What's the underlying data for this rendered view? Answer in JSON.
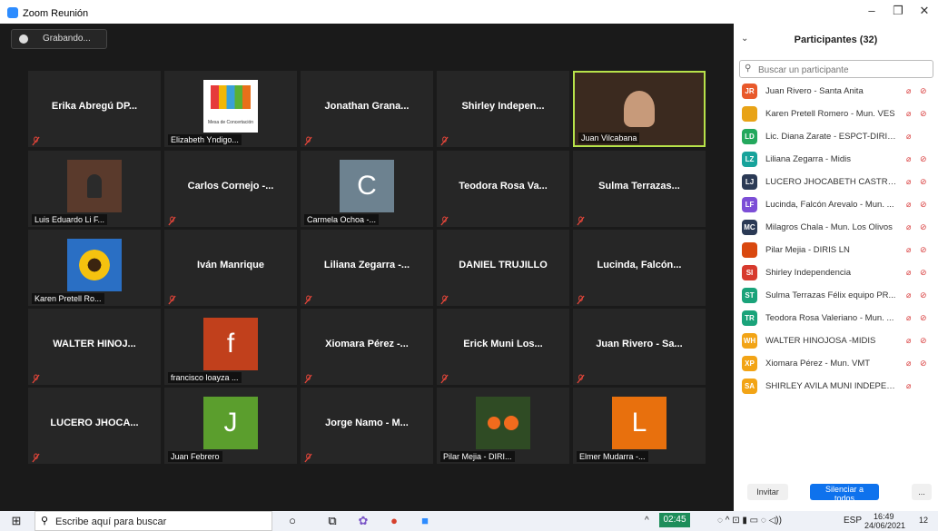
{
  "window": {
    "title": "Zoom Reunión",
    "minimize": "–",
    "maximize": "❐",
    "close": "✕"
  },
  "recording": {
    "label": "Grabando..."
  },
  "grid": [
    {
      "name": "Erika Abregú DP...",
      "label": "",
      "kind": "name"
    },
    {
      "name": "",
      "label": "Elizabeth Yndigo...",
      "kind": "logo",
      "logo_text": "Mesa de Concertación"
    },
    {
      "name": "Jonathan Grana...",
      "label": "",
      "kind": "name"
    },
    {
      "name": "Shirley Indepen...",
      "label": "",
      "kind": "name"
    },
    {
      "name": "",
      "label": "Juan Vilcabana",
      "kind": "video",
      "active": true
    },
    {
      "name": "",
      "label": "Luis Eduardo Li F...",
      "kind": "photo-person"
    },
    {
      "name": "Carlos Cornejo -...",
      "label": "",
      "kind": "name"
    },
    {
      "name": "",
      "label": "Carmela Ochoa -...",
      "kind": "letter",
      "letter": "C",
      "color": "#6d8290"
    },
    {
      "name": "Teodora Rosa Va...",
      "label": "",
      "kind": "name"
    },
    {
      "name": "Sulma Terrazas...",
      "label": "",
      "kind": "name"
    },
    {
      "name": "",
      "label": "Karen Pretell Ro...",
      "kind": "sunflower"
    },
    {
      "name": "Iván Manrique",
      "label": "",
      "kind": "name"
    },
    {
      "name": "Liliana Zegarra -...",
      "label": "",
      "kind": "name"
    },
    {
      "name": "DANIEL TRUJILLO",
      "label": "",
      "kind": "name"
    },
    {
      "name": "Lucinda, Falcón...",
      "label": "",
      "kind": "name"
    },
    {
      "name": "WALTER HINOJ...",
      "label": "",
      "kind": "name"
    },
    {
      "name": "",
      "label": "francisco loayza ...",
      "kind": "letter",
      "letter": "f",
      "color": "#c1401c"
    },
    {
      "name": "Xiomara Pérez -...",
      "label": "",
      "kind": "name"
    },
    {
      "name": "Erick Muni Los...",
      "label": "",
      "kind": "name"
    },
    {
      "name": "Juan Rivero - Sa...",
      "label": "",
      "kind": "name"
    },
    {
      "name": "LUCERO JHOCA...",
      "label": "",
      "kind": "name"
    },
    {
      "name": "",
      "label": "Juan Febrero",
      "kind": "letter",
      "letter": "J",
      "color": "#5b9e2d"
    },
    {
      "name": "Jorge Namo - M...",
      "label": "",
      "kind": "name"
    },
    {
      "name": "",
      "label": "Pilar Mejia - DIRI...",
      "kind": "flowers"
    },
    {
      "name": "",
      "label": "Elmer Mudarra -...",
      "kind": "letter",
      "letter": "L",
      "color": "#e8700d"
    }
  ],
  "panel": {
    "title": "Participantes (32)",
    "search_placeholder": "Buscar un participante",
    "participants": [
      {
        "initials": "JR",
        "name": "Juan Rivero - Santa Anita",
        "color": "#e8592b",
        "cam": true
      },
      {
        "initials": "",
        "name": "Karen Pretell Romero - Mun. VES",
        "color": "#e8a317",
        "cam": true
      },
      {
        "initials": "LD",
        "name": "Lic. Diana Zarate - ESPCT-DIRIS LN",
        "color": "#24a85d",
        "cam": false
      },
      {
        "initials": "LZ",
        "name": "Liliana Zegarra - Midis",
        "color": "#17a39b",
        "cam": true
      },
      {
        "initials": "LJ",
        "name": "LUCERO JHOCABETH CASTRO S...",
        "color": "#2b3a55",
        "cam": true
      },
      {
        "initials": "LF",
        "name": "Lucinda, Falcón Arevalo - Mun. ...",
        "color": "#7c4ed6",
        "cam": true
      },
      {
        "initials": "MC",
        "name": "Milagros Chala - Mun. Los Olivos",
        "color": "#2b3a55",
        "cam": true
      },
      {
        "initials": "",
        "name": "Pilar Mejia - DIRIS LN",
        "color": "#d9480f",
        "cam": true
      },
      {
        "initials": "SI",
        "name": "Shirley Independencia",
        "color": "#d73a2e",
        "cam": true
      },
      {
        "initials": "ST",
        "name": "Sulma Terrazas Félix equipo PR...",
        "color": "#1aa37a",
        "cam": true
      },
      {
        "initials": "TR",
        "name": "Teodora Rosa Valeriano - Mun. ...",
        "color": "#1aa37a",
        "cam": true
      },
      {
        "initials": "WH",
        "name": "WALTER HINOJOSA -MIDIS",
        "color": "#f2a416",
        "cam": true
      },
      {
        "initials": "XP",
        "name": "Xiomara Pérez - Mun. VMT",
        "color": "#f2a416",
        "cam": true
      },
      {
        "initials": "SA",
        "name": "SHIRLEY AVILA MUNI INDEPENDENCIA",
        "color": "#f2a416",
        "cam": false
      }
    ],
    "invite": "Invitar",
    "mute_all": "Silenciar a todos",
    "more": "..."
  },
  "taskbar": {
    "search_text": "Escribe aquí para buscar",
    "timer": "02:45",
    "lang": "ESP",
    "time": "16:49",
    "date": "24/06/2021",
    "notifications": "12"
  }
}
